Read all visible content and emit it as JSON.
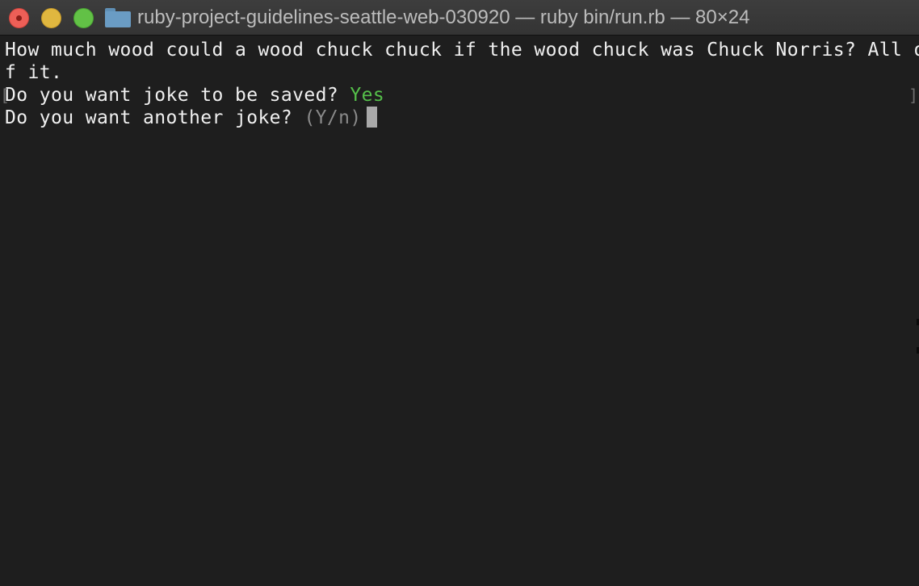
{
  "window": {
    "title": "ruby-project-guidelines-seattle-web-030920 — ruby bin/run.rb — 80×24",
    "folder_icon": "folder-icon"
  },
  "terminal": {
    "joke_line_1": "How much wood could a wood chuck chuck if the wood chuck was Chuck Norris? All o",
    "joke_line_2": "f it.",
    "save_prompt": "Do you want joke to be saved? ",
    "save_answer": "Yes",
    "another_prompt": "Do you want another joke? ",
    "another_hint": "(Y/n)",
    "bracket_left": "[",
    "bracket_right": "]"
  },
  "colors": {
    "background": "#1e1e1e",
    "text": "#f0f0f0",
    "answer": "#55c04a",
    "hint": "#8a8a8a",
    "cursor": "#a9a9a9"
  }
}
